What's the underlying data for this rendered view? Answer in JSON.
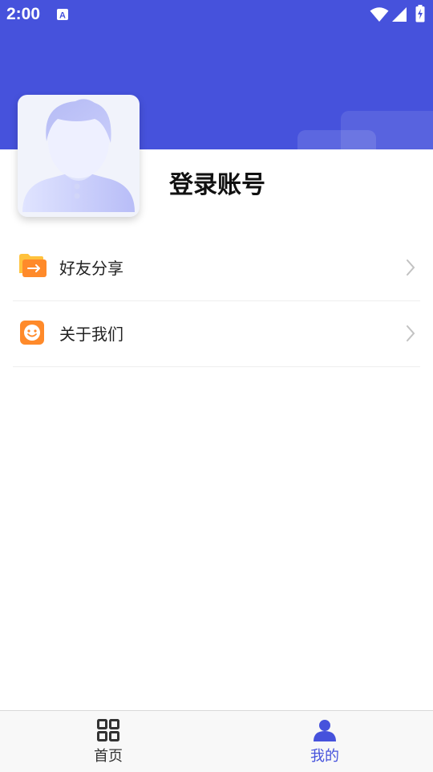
{
  "status_bar": {
    "time": "2:00"
  },
  "profile": {
    "login_label": "登录账号"
  },
  "menu": [
    {
      "label": "好友分享",
      "icon": "share-folder-icon"
    },
    {
      "label": "关于我们",
      "icon": "smiley-icon"
    }
  ],
  "bottom_nav": [
    {
      "label": "首页",
      "icon": "grid-icon",
      "active": false
    },
    {
      "label": "我的",
      "icon": "user-icon",
      "active": true
    }
  ],
  "colors": {
    "primary": "#4652dc",
    "inactive": "#333333",
    "accent_orange": "#ff8a2a"
  }
}
